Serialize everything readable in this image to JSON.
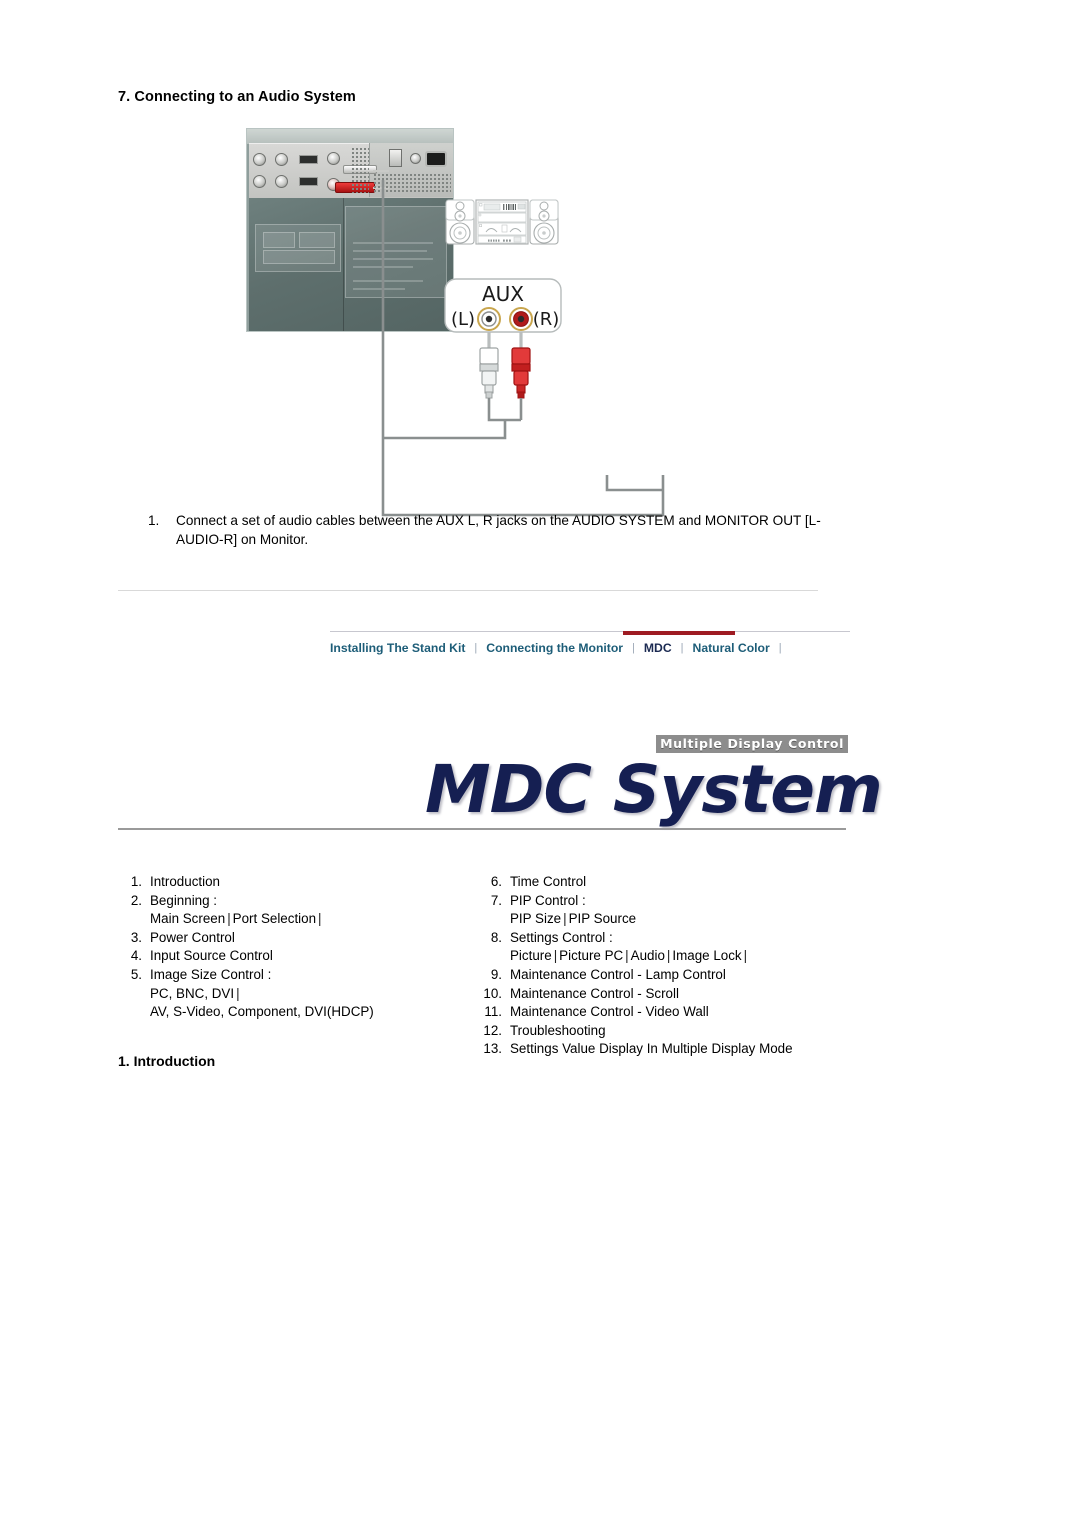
{
  "page": {
    "section_heading": "7. Connecting to an Audio System",
    "intro_heading": "1. Introduction"
  },
  "photo": {
    "alt_name": "monitor-rear-panel-photo"
  },
  "diagram": {
    "aux_label": "AUX",
    "left_channel_label": "(L)",
    "right_channel_label": "(R)",
    "stereo_name": "audio-system-illustration",
    "plug_left_name": "rca-plug-white-left",
    "plug_right_name": "rca-plug-red-right"
  },
  "step": {
    "number": "1.",
    "text": "Connect a set of audio cables between the AUX L, R jacks on the AUDIO SYSTEM and MONITOR OUT [L-AUDIO-R] on Monitor."
  },
  "tabbar": {
    "separator": "|",
    "tabs": [
      {
        "label": "Installing The Stand Kit",
        "active": false
      },
      {
        "label": "Connecting the Monitor",
        "active": false
      },
      {
        "label": "MDC",
        "active": true
      },
      {
        "label": "Natural Color",
        "active": false
      }
    ],
    "active_color": "#9e1b22"
  },
  "logo": {
    "badge": "Multiple Display Control",
    "title": "MDC System",
    "color": "#151f52"
  },
  "toc": {
    "link_color": "#41699c",
    "left": [
      {
        "n": "1.",
        "main": "Introduction",
        "main_is_link": true,
        "subs": []
      },
      {
        "n": "2.",
        "main": "Beginning :",
        "main_is_link": false,
        "subs": [
          {
            "parts": [
              "Main Screen",
              "Port Selection",
              ""
            ]
          }
        ]
      },
      {
        "n": "3.",
        "main": "Power Control",
        "main_is_link": true,
        "subs": []
      },
      {
        "n": "4.",
        "main": "Input Source Control",
        "main_is_link": true,
        "subs": []
      },
      {
        "n": "5.",
        "main": "Image Size Control :",
        "main_is_link": false,
        "subs": [
          {
            "parts": [
              "PC, BNC, DVI",
              ""
            ]
          },
          {
            "parts": [
              "AV, S-Video, Component, DVI(HDCP)"
            ]
          }
        ]
      }
    ],
    "right": [
      {
        "n": "6.",
        "main": "Time Control",
        "main_is_link": true,
        "subs": []
      },
      {
        "n": "7.",
        "main": "PIP Control :",
        "main_is_link": false,
        "subs": [
          {
            "parts": [
              "PIP Size",
              "PIP Source"
            ]
          }
        ]
      },
      {
        "n": "8.",
        "main": "Settings Control :",
        "main_is_link": false,
        "subs": [
          {
            "parts": [
              "Picture",
              "Picture PC",
              "Audio",
              "Image Lock",
              ""
            ]
          }
        ]
      },
      {
        "n": "9.",
        "main": "Maintenance Control - Lamp Control",
        "main_is_link": true,
        "subs": []
      },
      {
        "n": "10.",
        "main": "Maintenance Control - Scroll",
        "main_is_link": true,
        "subs": []
      },
      {
        "n": "11.",
        "main": "Maintenance Control - Video Wall",
        "main_is_link": true,
        "subs": []
      },
      {
        "n": "12.",
        "main": "Troubleshooting",
        "main_is_link": true,
        "subs": []
      },
      {
        "n": "13.",
        "main": "Settings Value Display In Multiple Display Mode",
        "main_is_link": true,
        "subs": []
      }
    ]
  }
}
